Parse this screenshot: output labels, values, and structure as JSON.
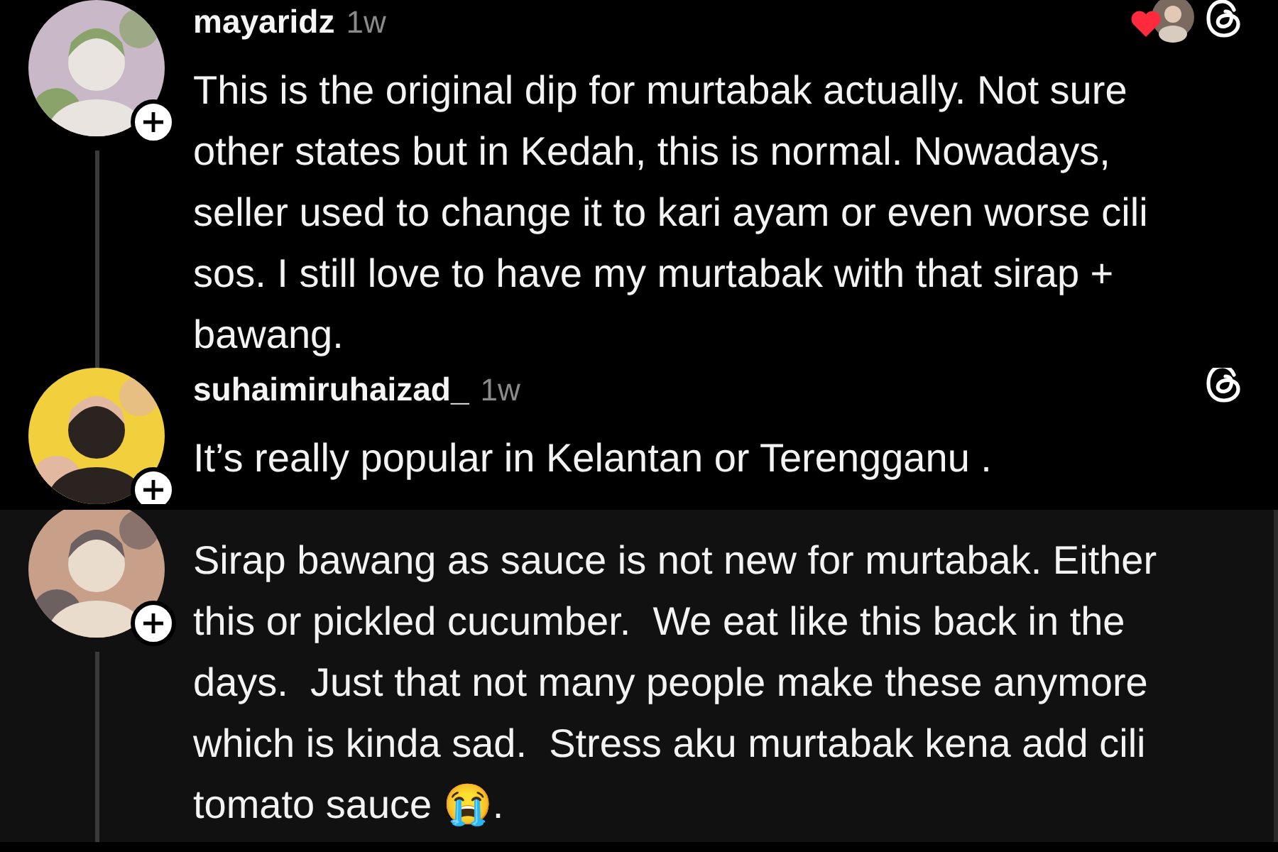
{
  "comments": [
    {
      "username": "mayaridz",
      "time": "1w",
      "liked_by_author": true,
      "threads_icon": true,
      "text": "This is the original dip for murtabak actually. Not sure other states but in Kedah, this is normal. Nowadays, seller used to change it to kari ayam or even worse cili sos. I still love to have my murtabak with that sirap + bawang."
    },
    {
      "username": "suhaimiruhaizad_",
      "time": "1w",
      "liked_by_author": false,
      "threads_icon": true,
      "text": "It’s really popular in Kelantan or Terengganu ."
    },
    {
      "liked_by_author": false,
      "threads_icon": false,
      "text": "Sirap bawang as sauce is not new for murtabak. Either this or pickled cucumber.  We eat like this back in the days.  Just that not many people make these anymore which is kinda sad.  Stress aku murtabak kena add cili tomato sauce 😭."
    }
  ]
}
